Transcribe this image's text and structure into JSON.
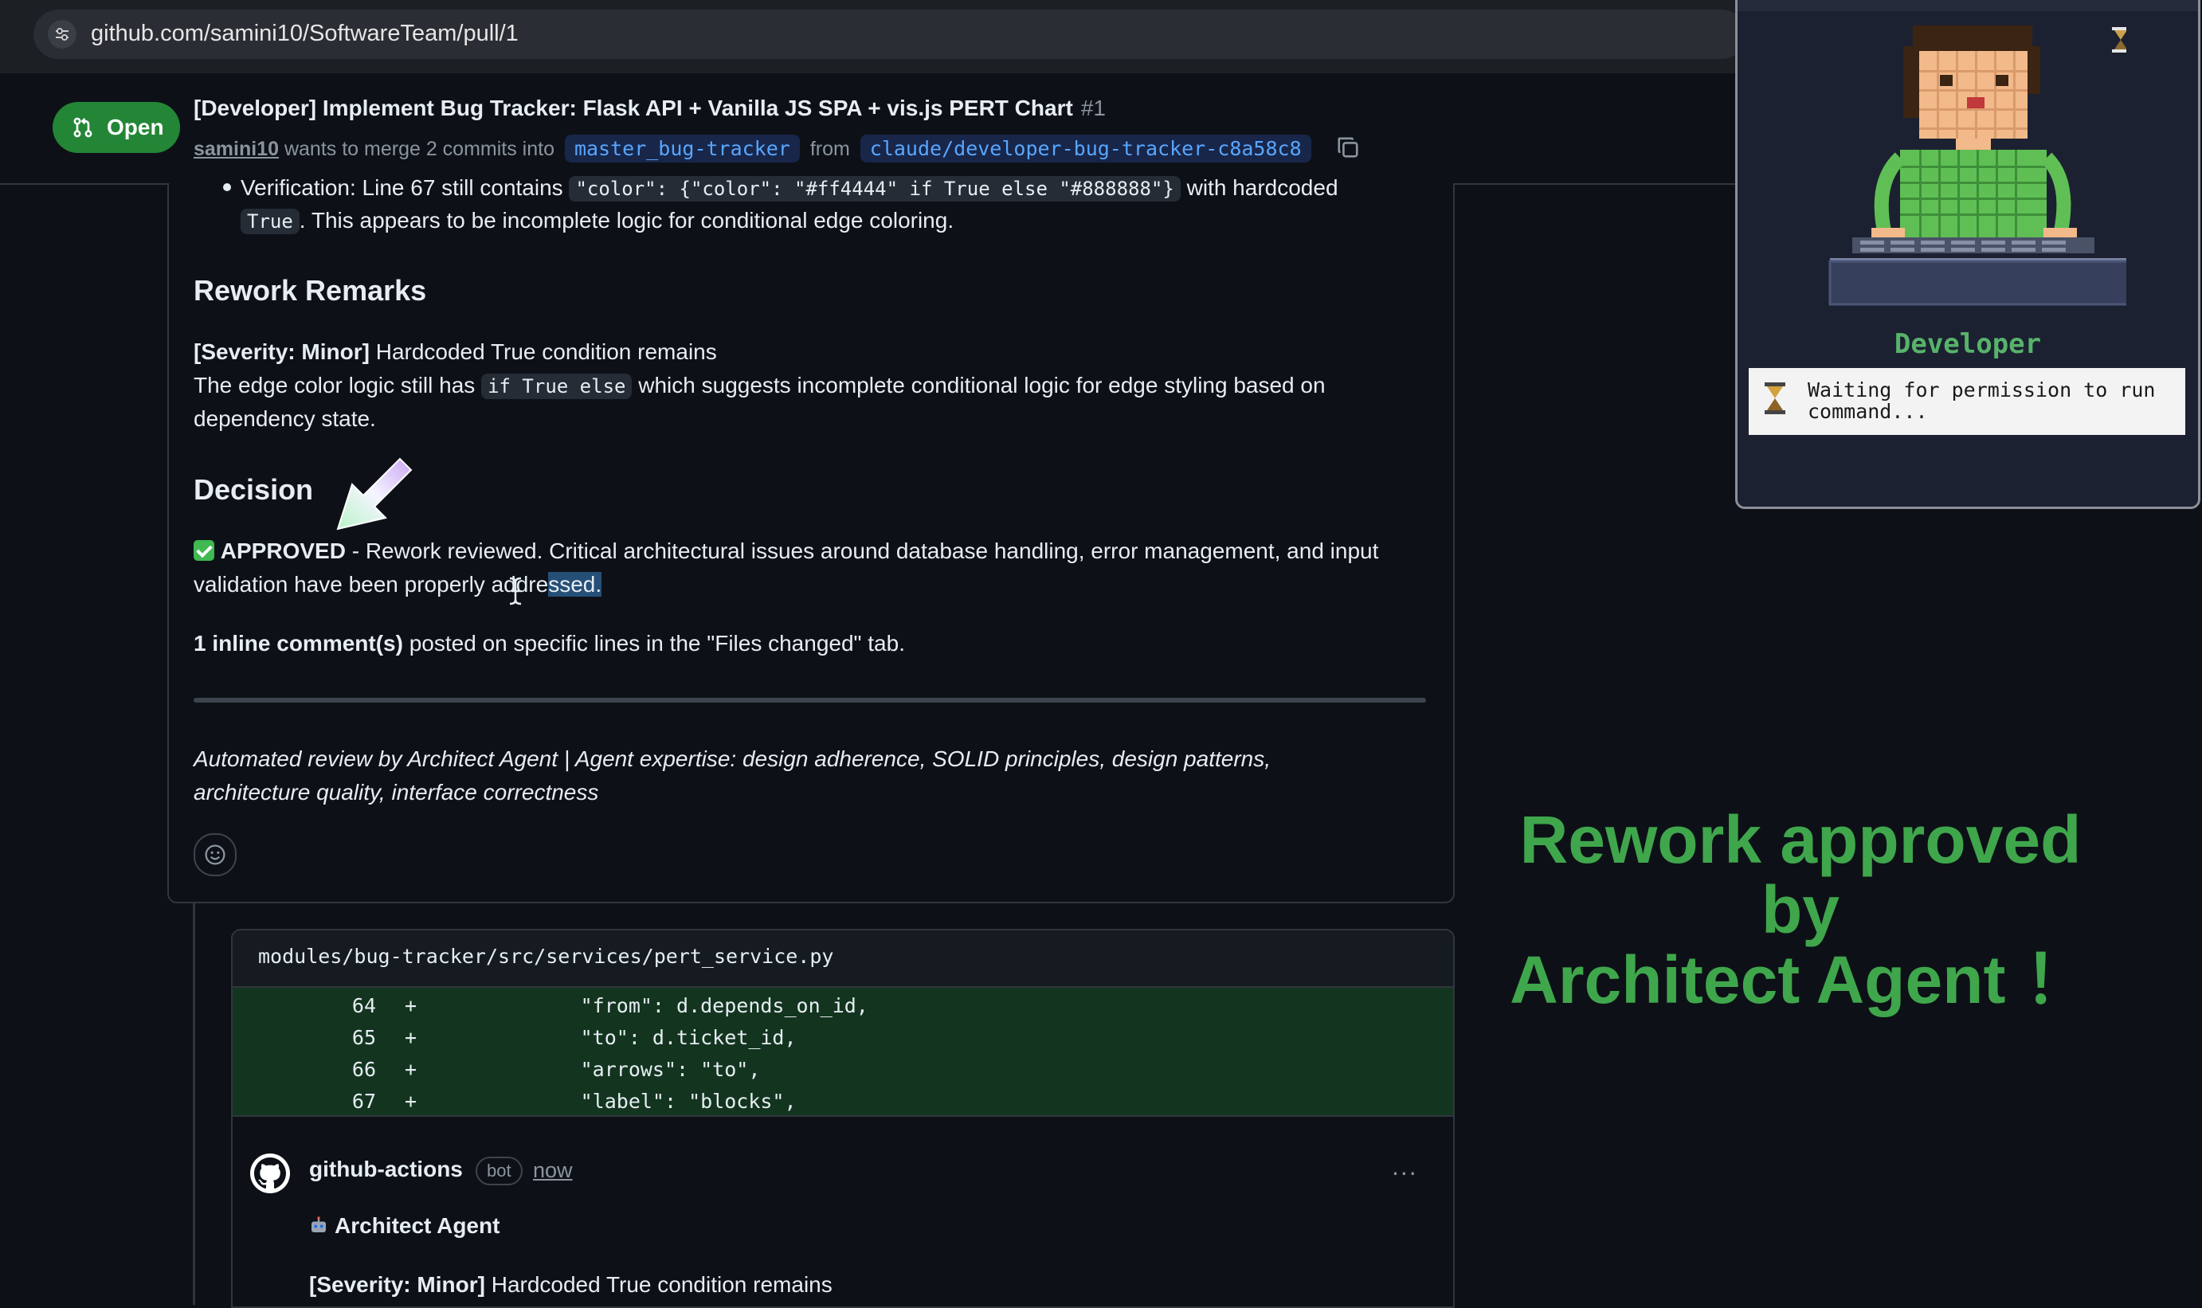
{
  "browser": {
    "url": "github.com/samini10/SoftwareTeam/pull/1"
  },
  "pr": {
    "state": "Open",
    "title": "[Developer] Implement Bug Tracker: Flask API + Vanilla JS SPA + vis.js PERT Chart",
    "number": "#1",
    "author": "samini10",
    "merge_text": "wants to merge 2 commits into",
    "base_branch": "master_bug-tracker",
    "from_text": "from",
    "head_branch": "claude/developer-bug-tracker-c8a58c8"
  },
  "comment": {
    "verification_line1_a": "Verification: Line 67 still contains",
    "verification_code": "\"color\": {\"color\": \"#ff4444\" if True else \"#888888\"}",
    "verification_line1_b": "with hardcoded",
    "verification_true_code": "True",
    "verification_line2": ". This appears to be incomplete logic for conditional edge coloring.",
    "rework_heading": "Rework Remarks",
    "rework_severity": "[Severity: Minor]",
    "rework_severity_text": "Hardcoded True condition remains",
    "rework_desc_a": "The edge color logic still has",
    "rework_code": "if True else",
    "rework_desc_b": "which suggests incomplete conditional logic for edge styling based on",
    "rework_desc_c": "dependency state.",
    "decision_heading": "Decision",
    "approved_label": "APPROVED",
    "approved_text_a": "- Rework reviewed. Critical architectural issues around database handling, error management, and input",
    "approved_text_b": "validation have been properly addre",
    "approved_text_selected": "ssed.",
    "inline_bold": "1 inline comment(s)",
    "inline_text": "posted on specific lines in the \"Files changed\" tab.",
    "footer_line1": "Automated review by Architect Agent | Agent expertise: design adherence, SOLID principles, design patterns,",
    "footer_line2": "architecture quality, interface correctness"
  },
  "diff": {
    "path": "modules/bug-tracker/src/services/pert_service.py",
    "rows": [
      {
        "line": "64",
        "sign": "+",
        "code": "            \"from\": d.depends_on_id,"
      },
      {
        "line": "65",
        "sign": "+",
        "code": "            \"to\": d.ticket_id,"
      },
      {
        "line": "66",
        "sign": "+",
        "code": "            \"arrows\": \"to\","
      },
      {
        "line": "67",
        "sign": "+",
        "code": "            \"label\": \"blocks\","
      }
    ],
    "comment_author": "github-actions",
    "comment_badge": "bot",
    "comment_time": "now",
    "comment_menu": "...",
    "comment_title": "Architect Agent",
    "comment_severity": "[Severity: Minor]",
    "comment_severity_text": "Hardcoded True condition remains"
  },
  "overlay": {
    "line1": "Rework approved",
    "line2": "by",
    "line3": "Architect Agent ！"
  },
  "agent_panel": {
    "name": "Developer",
    "status": "Waiting for permission to run command..."
  },
  "colors": {
    "accent_green": "#238636",
    "overlay_green": "#3fa64c",
    "agent_green": "#57b36a",
    "branch_blue": "#58a6ff",
    "diff_add_bg": "#13351f"
  }
}
